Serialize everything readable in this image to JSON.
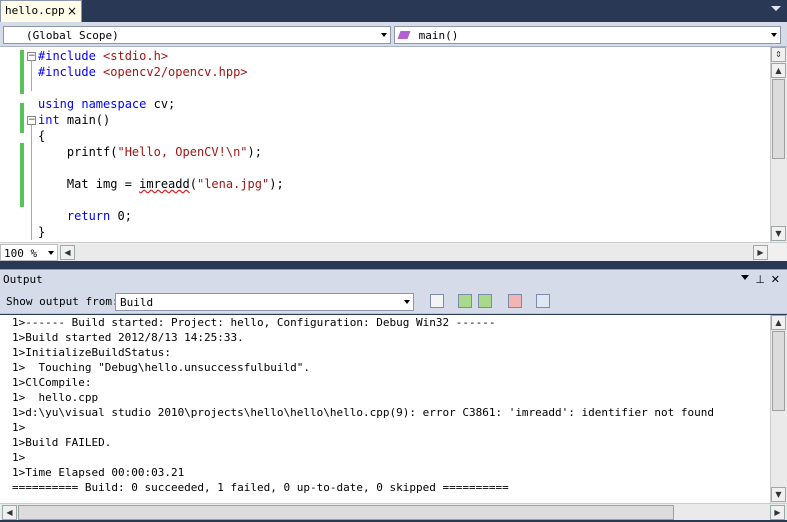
{
  "editor_tab": {
    "label": "hello.cpp",
    "close": "×"
  },
  "navbar": {
    "scope": "(Global Scope)",
    "member": "main()"
  },
  "code_lines": [
    {
      "pre": "",
      "kw": "#include",
      "post": " ",
      "str": "<stdio.h>",
      "tail": ""
    },
    {
      "pre": "",
      "kw": "#include",
      "post": " ",
      "str": "<opencv2/opencv.hpp>",
      "tail": ""
    },
    {
      "pre": "",
      "kw": "",
      "post": "",
      "str": "",
      "tail": ""
    },
    {
      "pre": "",
      "kw": "using namespace",
      "post": " cv;",
      "str": "",
      "tail": ""
    },
    {
      "pre": "",
      "kw": "int",
      "post": " main()",
      "str": "",
      "tail": ""
    },
    {
      "pre": "{",
      "kw": "",
      "post": "",
      "str": "",
      "tail": ""
    },
    {
      "pre": "    printf(",
      "kw": "",
      "post": "",
      "str": "\"Hello, OpenCV!\\n\"",
      "tail": ");"
    },
    {
      "pre": "",
      "kw": "",
      "post": "",
      "str": "",
      "tail": ""
    },
    {
      "pre": "    Mat img = ",
      "kw": "",
      "post": "",
      "str": "",
      "tail": ""
    },
    {
      "pre": "",
      "kw": "",
      "post": "",
      "str": "",
      "tail": ""
    },
    {
      "pre": "    ",
      "kw": "return",
      "post": " 0;",
      "str": "",
      "tail": ""
    },
    {
      "pre": "}",
      "kw": "",
      "post": "",
      "str": "",
      "tail": ""
    }
  ],
  "imread_line": {
    "indent": "    Mat img = ",
    "func": "imreadd",
    "open": "(",
    "str": "\"lena.jpg\"",
    "close": ");"
  },
  "zoom": "100 %",
  "output": {
    "title": "Output",
    "show_label": "Show output from:",
    "source": "Build",
    "lines": [
      "1>------ Build started: Project: hello, Configuration: Debug Win32 ------",
      "1>Build started 2012/8/13 14:25:33.",
      "1>InitializeBuildStatus:",
      "1>  Touching \"Debug\\hello.unsuccessfulbuild\".",
      "1>ClCompile:",
      "1>  hello.cpp",
      "1>d:\\yu\\visual studio 2010\\projects\\hello\\hello\\hello.cpp(9): error C3861: 'imreadd': identifier not found",
      "1>",
      "1>Build FAILED.",
      "1>",
      "1>Time Elapsed 00:00:03.21",
      "========== Build: 0 succeeded, 1 failed, 0 up-to-date, 0 skipped =========="
    ]
  },
  "colors": {
    "chrome": "#293955",
    "keyword": "#0000ff",
    "string": "#a31515",
    "changed_margin": "#56c456"
  }
}
